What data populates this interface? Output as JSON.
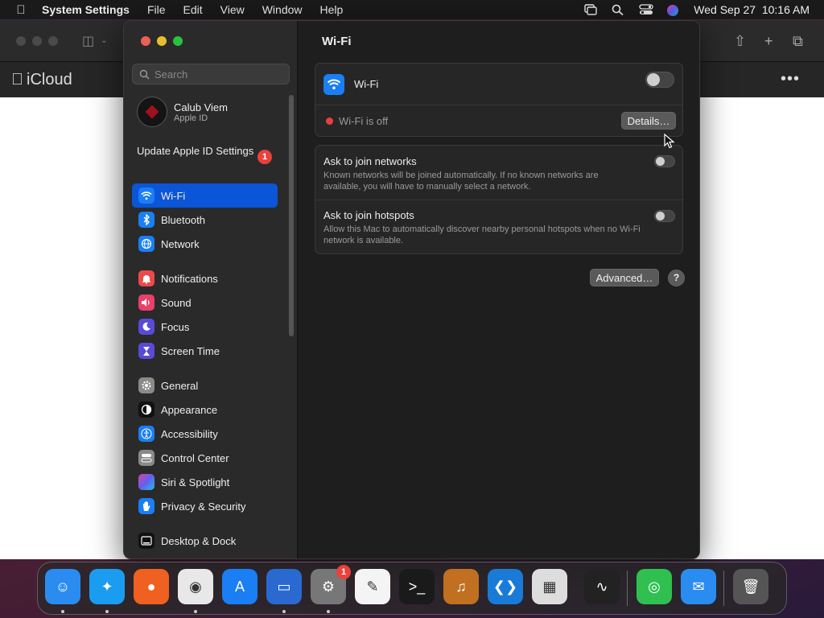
{
  "menubar": {
    "app_name": "System Settings",
    "menus": [
      "File",
      "Edit",
      "View",
      "Window",
      "Help"
    ],
    "clock": "Wed Sep 27  10:16 AM"
  },
  "background_window": {
    "title": "iCloud"
  },
  "sidebar": {
    "search_placeholder": "Search",
    "account": {
      "name": "Calub Viem",
      "subtitle": "Apple ID"
    },
    "update": {
      "label": "Update Apple ID Settings",
      "badge": "1"
    },
    "items": [
      {
        "label": "Wi-Fi",
        "icon": "wifi-icon",
        "color": "#1a7ef5",
        "selected": true
      },
      {
        "label": "Bluetooth",
        "icon": "bluetooth-icon",
        "color": "#1a7ef5"
      },
      {
        "label": "Network",
        "icon": "globe-icon",
        "color": "#1a7ef5"
      },
      {
        "label": "Notifications",
        "icon": "bell-icon",
        "color": "#ec4a4a"
      },
      {
        "label": "Sound",
        "icon": "speaker-icon",
        "color": "#e8406a"
      },
      {
        "label": "Focus",
        "icon": "moon-icon",
        "color": "#5a4ad8"
      },
      {
        "label": "Screen Time",
        "icon": "hourglass-icon",
        "color": "#5a4ad8"
      },
      {
        "label": "General",
        "icon": "gear-icon",
        "color": "#8a8a8a"
      },
      {
        "label": "Appearance",
        "icon": "appearance-icon",
        "color": "#111111"
      },
      {
        "label": "Accessibility",
        "icon": "accessibility-icon",
        "color": "#1a7ef5"
      },
      {
        "label": "Control Center",
        "icon": "control-center-icon",
        "color": "#8a8a8a"
      },
      {
        "label": "Siri & Spotlight",
        "icon": "siri-icon",
        "color": "#b040c0"
      },
      {
        "label": "Privacy & Security",
        "icon": "hand-icon",
        "color": "#1a7ef5"
      },
      {
        "label": "Desktop & Dock",
        "icon": "desktop-icon",
        "color": "#111111"
      }
    ]
  },
  "content": {
    "title": "Wi-Fi",
    "wifi": {
      "label": "Wi-Fi",
      "enabled": false,
      "status": "Wi-Fi is off",
      "status_color": "#e8413e",
      "details_label": "Details…"
    },
    "options": [
      {
        "title": "Ask to join networks",
        "description": "Known networks will be joined automatically. If no known networks are available, you will have to manually select a network.",
        "enabled": false
      },
      {
        "title": "Ask to join hotspots",
        "description": "Allow this Mac to automatically discover nearby personal hotspots when no Wi-Fi network is available.",
        "enabled": false
      }
    ],
    "advanced_label": "Advanced…",
    "help_label": "?"
  },
  "dock": {
    "apps": [
      {
        "name": "finder-app",
        "icon": "☺",
        "color": "#2a8cf0",
        "running": true
      },
      {
        "name": "safari-app",
        "icon": "✦",
        "color": "#1a9cf0",
        "running": true
      },
      {
        "name": "firefox-app",
        "icon": "●",
        "color": "#f06020",
        "running": false
      },
      {
        "name": "chrome-app",
        "icon": "◉",
        "color": "#e8e8e8",
        "running": true
      },
      {
        "name": "app-store-app",
        "icon": "A",
        "color": "#1a7ef5",
        "running": false
      },
      {
        "name": "remote-desktop-app",
        "icon": "▭",
        "color": "#2a6ad0",
        "running": true
      },
      {
        "name": "system-settings-app",
        "icon": "⚙",
        "color": "#777777",
        "running": true,
        "badge": "1"
      },
      {
        "name": "textedit-app",
        "icon": "✎",
        "color": "#f4f4f4",
        "running": false
      },
      {
        "name": "terminal-app",
        "icon": ">_",
        "color": "#1a1a1a",
        "running": false
      },
      {
        "name": "garageband-app",
        "icon": "♫",
        "color": "#c07020",
        "running": false
      },
      {
        "name": "vscode-app",
        "icon": "❮❯",
        "color": "#1a7ad8",
        "running": false
      },
      {
        "name": "launchpad-app",
        "icon": "▦",
        "color": "#dddddd",
        "running": false
      },
      {
        "name": "voice-memos-app",
        "icon": "∿",
        "color": "#222222",
        "running": false
      },
      {
        "name": "find-my-app",
        "icon": "◎",
        "color": "#30c050",
        "running": false
      },
      {
        "name": "mail-app",
        "icon": "✉",
        "color": "#2a8cf0",
        "running": false
      },
      {
        "name": "trash-app",
        "icon": "🗑",
        "color": "#555555",
        "running": false
      }
    ]
  }
}
